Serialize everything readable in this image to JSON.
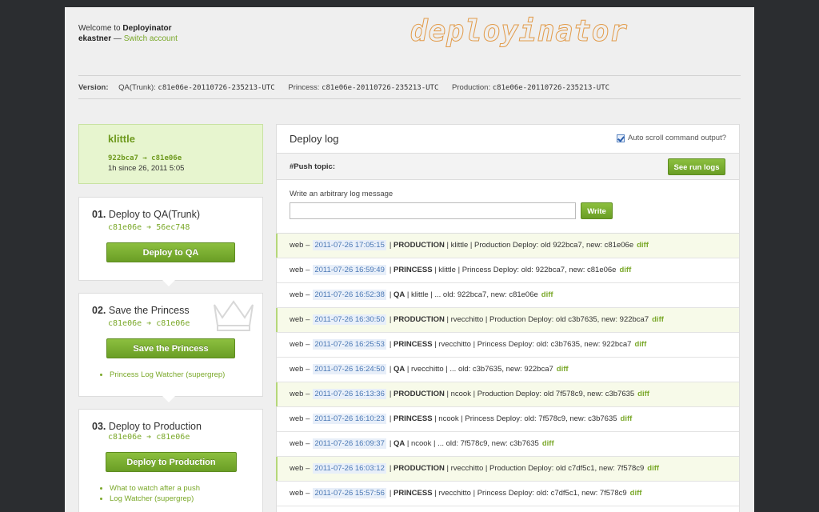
{
  "header": {
    "welcome_prefix": "Welcome to",
    "app_name": "Deployinator",
    "username": "ekastner",
    "dash": "—",
    "switch_account": "Switch account",
    "logo_text": "deployinator"
  },
  "versions": {
    "label": "Version:",
    "items": [
      {
        "env": "QA(Trunk):",
        "sha": "c81e06e-20110726-235213-UTC"
      },
      {
        "env": "Princess:",
        "sha": "c81e06e-20110726-235213-UTC"
      },
      {
        "env": "Production:",
        "sha": "c81e06e-20110726-235213-UTC"
      }
    ]
  },
  "current": {
    "user": "klittle",
    "sha_range": "922bca7 → c81e06e",
    "since": "1h since 26, 2011 5:05"
  },
  "steps": [
    {
      "num": "01.",
      "title": "Deploy to QA(Trunk)",
      "sha": "c81e06e ➔ 56ec748",
      "button": "Deploy to QA",
      "links": []
    },
    {
      "num": "02.",
      "title": "Save the Princess",
      "sha": "c81e06e ➔ c81e06e",
      "button": "Save the Princess",
      "links": [
        "Princess Log Watcher (supergrep)"
      ]
    },
    {
      "num": "03.",
      "title": "Deploy to Production",
      "sha": "c81e06e ➔ c81e06e",
      "button": "Deploy to Production",
      "links": [
        "What to watch after a push",
        "Log Watcher (supergrep)"
      ]
    }
  ],
  "log": {
    "title": "Deploy log",
    "auto_scroll_label": "Auto scroll command output?",
    "auto_scroll_checked": true,
    "push_topic_label": "#Push topic:",
    "see_run_logs": "See run logs",
    "write_label": "Write an arbitrary log message",
    "write_placeholder": "",
    "write_button": "Write",
    "entries": [
      {
        "src": "web –",
        "ts": "2011-07-26 17:05:15",
        "env": "PRODUCTION",
        "rest": "| klittle | Production Deploy: old 922bca7, new: c81e06e",
        "diff": "diff"
      },
      {
        "src": "web –",
        "ts": "2011-07-26 16:59:49",
        "env": "PRINCESS",
        "rest": "| klittle | Princess Deploy: old: 922bca7, new: c81e06e",
        "diff": "diff"
      },
      {
        "src": "web –",
        "ts": "2011-07-26 16:52:38",
        "env": "QA",
        "rest": "| klittle | ... old: 922bca7, new: c81e06e",
        "diff": "diff"
      },
      {
        "src": "web –",
        "ts": "2011-07-26 16:30:50",
        "env": "PRODUCTION",
        "rest": "| rvecchitto | Production Deploy: old c3b7635, new: 922bca7",
        "diff": "diff"
      },
      {
        "src": "web –",
        "ts": "2011-07-26 16:25:53",
        "env": "PRINCESS",
        "rest": "| rvecchitto | Princess Deploy: old: c3b7635, new: 922bca7",
        "diff": "diff"
      },
      {
        "src": "web –",
        "ts": "2011-07-26 16:24:50",
        "env": "QA",
        "rest": "| rvecchitto | ... old: c3b7635, new: 922bca7",
        "diff": "diff"
      },
      {
        "src": "web –",
        "ts": "2011-07-26 16:13:36",
        "env": "PRODUCTION",
        "rest": "| ncook | Production Deploy: old 7f578c9, new: c3b7635",
        "diff": "diff"
      },
      {
        "src": "web –",
        "ts": "2011-07-26 16:10:23",
        "env": "PRINCESS",
        "rest": "| ncook | Princess Deploy: old: 7f578c9, new: c3b7635",
        "diff": "diff"
      },
      {
        "src": "web –",
        "ts": "2011-07-26 16:09:37",
        "env": "QA",
        "rest": "| ncook | ... old: 7f578c9, new: c3b7635",
        "diff": "diff"
      },
      {
        "src": "web –",
        "ts": "2011-07-26 16:03:12",
        "env": "PRODUCTION",
        "rest": "| rvecchitto | Production Deploy: old c7df5c1, new: 7f578c9",
        "diff": "diff"
      },
      {
        "src": "web –",
        "ts": "2011-07-26 15:57:56",
        "env": "PRINCESS",
        "rest": "| rvecchitto | Princess Deploy: old: c7df5c1, new: 7f578c9",
        "diff": "diff"
      }
    ]
  },
  "colors": {
    "accent_green": "#7aa829",
    "button_green": "#6a9e25",
    "logo_orange": "#e29b4a",
    "timestamp_blue": "#4a78b5"
  }
}
